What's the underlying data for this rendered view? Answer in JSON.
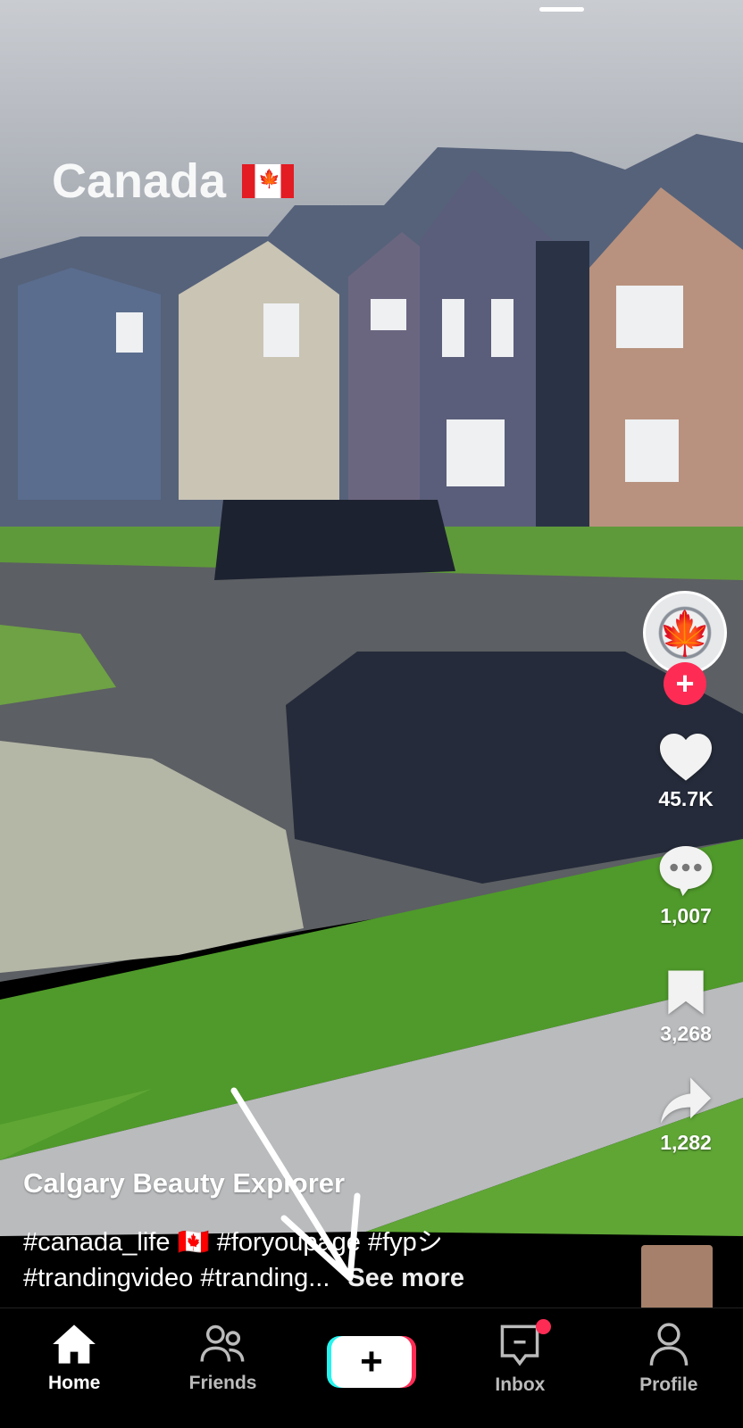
{
  "video": {
    "overlay_text": "Canada",
    "author": "Calgary Beauty Explorer",
    "description_line1": "#canada_life 🇨🇦 #foryoupage #fypシ",
    "description_line2": "#trandingvideo #tranding...",
    "see_more": "See more"
  },
  "actions": {
    "likes": "45.7K",
    "comments": "1,007",
    "saves": "3,268",
    "shares": "1,282"
  },
  "nav": [
    {
      "label": "Home",
      "icon": "home-icon",
      "active": true
    },
    {
      "label": "Friends",
      "icon": "friends-icon"
    },
    {
      "label": "",
      "icon": "create-plus-icon"
    },
    {
      "label": "Inbox",
      "icon": "inbox-icon",
      "badge": true
    },
    {
      "label": "Profile",
      "icon": "profile-icon"
    }
  ],
  "colors": {
    "accent": "#fe2c55",
    "cyan": "#25f4ee",
    "background": "#000000"
  }
}
